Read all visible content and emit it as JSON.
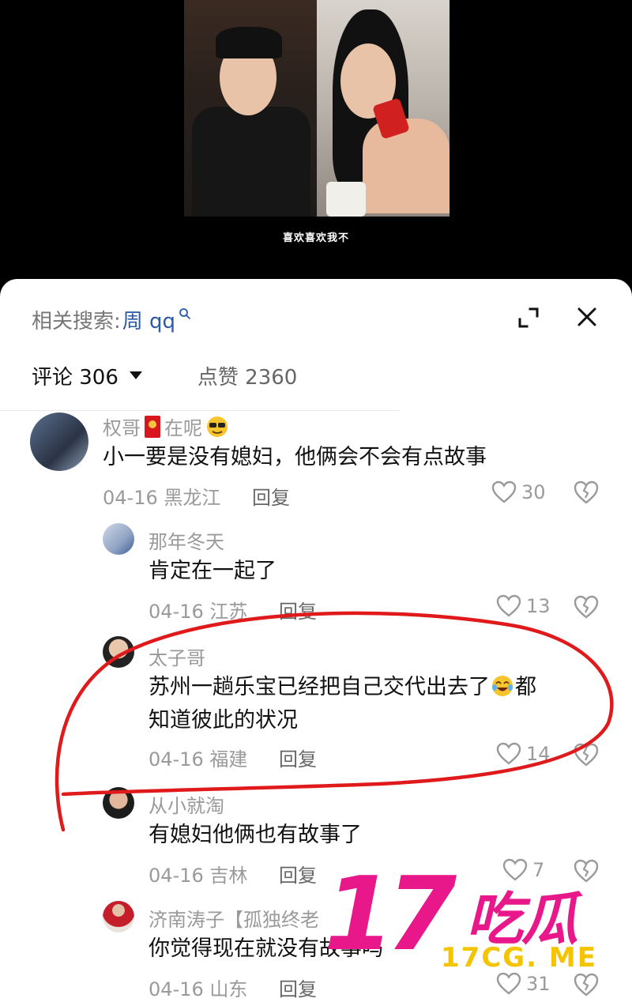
{
  "video": {
    "subtitle": "喜欢喜欢我不"
  },
  "sheet": {
    "search_label": "相关搜索:",
    "search_query": "周 qq",
    "tabs": [
      {
        "label": "评论 306"
      },
      {
        "label": "点赞 2360"
      }
    ]
  },
  "comments": [
    {
      "name": "权哥",
      "name_suffix": "在呢",
      "text": "小一要是没有媳妇，他俩会不会有点故事",
      "date": "04-16",
      "location": "黑龙江",
      "reply_label": "回复",
      "likes": "30"
    },
    {
      "name": "那年冬天",
      "text": "肯定在一起了",
      "date": "04-16",
      "location": "江苏",
      "reply_label": "回复",
      "likes": "13"
    },
    {
      "name": "太子哥",
      "text_line1": "苏州一趟乐宝已经把自己交代出去了",
      "text_line1_end": "都",
      "text_line2": "知道彼此的状况",
      "date": "04-16",
      "location": "福建",
      "reply_label": "回复",
      "likes": "14"
    },
    {
      "name": "从小就淘",
      "text": "有媳妇他俩也有故事了",
      "date": "04-16",
      "location": "吉林",
      "reply_label": "回复",
      "likes": "7"
    },
    {
      "name": "济南涛子【孤独终老",
      "text": "你觉得现在就没有故事吗",
      "date": "04-16",
      "location": "山东",
      "reply_label": "回复",
      "likes": "31"
    }
  ],
  "watermark": {
    "number": "17",
    "chinese": "吃瓜",
    "domain": "17CG. ME"
  },
  "colors": {
    "annotation_red": "#e0191a",
    "watermark_pink": "#e8178a",
    "watermark_yellow": "#f4c400",
    "link_blue": "#2b5aa8"
  }
}
